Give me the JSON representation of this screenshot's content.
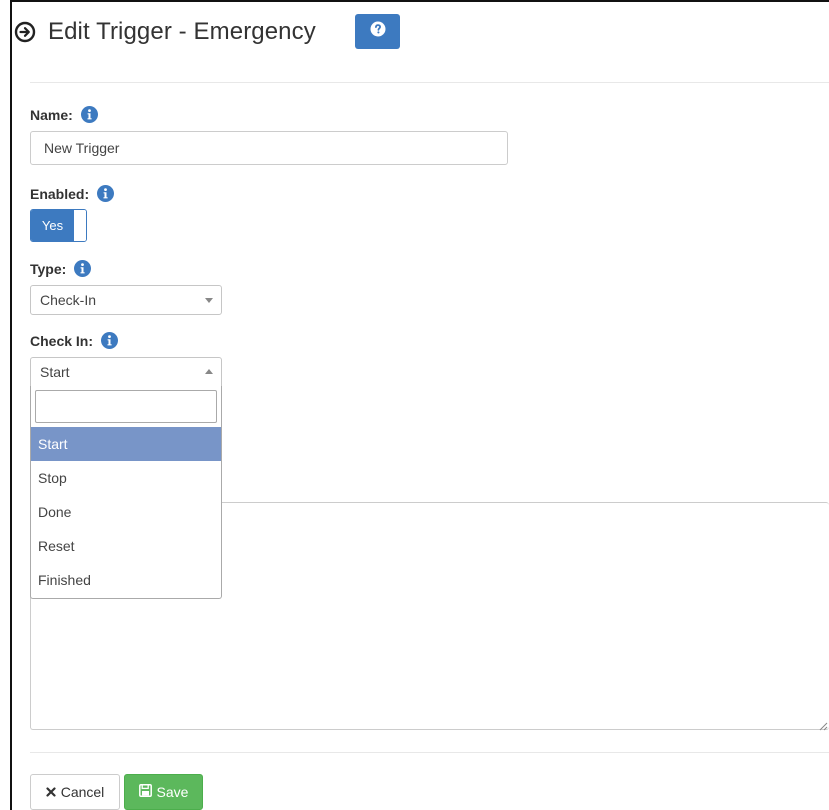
{
  "header": {
    "title": "Edit Trigger - Emergency",
    "help_icon": "question-circle-icon",
    "title_icon": "arrow-circle-right-icon"
  },
  "form": {
    "name": {
      "label": "Name:",
      "value": "New Trigger"
    },
    "enabled": {
      "label": "Enabled:",
      "toggle_label": "Yes",
      "state": "on"
    },
    "type": {
      "label": "Type:",
      "value": "Check-In"
    },
    "check_in": {
      "label": "Check In:",
      "value": "Start",
      "search_value": "",
      "options": [
        "Start",
        "Stop",
        "Done",
        "Reset",
        "Finished"
      ],
      "selected_option": "Start"
    }
  },
  "footer": {
    "cancel_label": "Cancel",
    "save_label": "Save"
  },
  "colors": {
    "primary": "#3d7ac0",
    "selected_option": "#7895c8",
    "success": "#5cb85c"
  }
}
